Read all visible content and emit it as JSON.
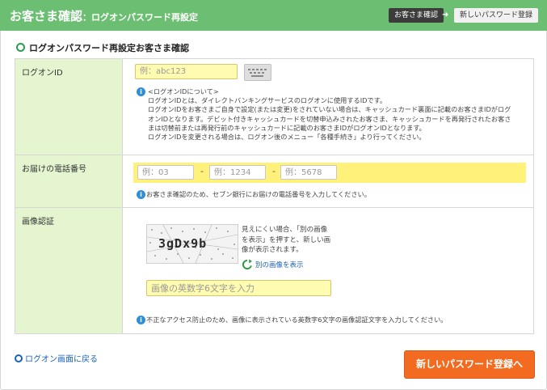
{
  "header": {
    "title": "お客さま確認",
    "subtitle": "：ログオンパスワード再設定",
    "steps": {
      "current": "お客さま確認",
      "next": "新しいパスワード登録"
    },
    "arrow": "➜"
  },
  "section": {
    "heading": "ログオンパスワード再設定お客さま確認"
  },
  "logon": {
    "label": "ログオンID",
    "placeholder": "例：abc123",
    "note_lines": [
      "<ログオンIDについて>",
      "ログオンIDとは、ダイレクトバンキングサービスのログオンに使用するIDです。",
      "ログオンIDをお客さまご自身で設定(または変更)をされていない場合は、キャッシュカード裏面に記載のお客さまIDがログ",
      "オンIDとなります。デビット付きキャッシュカードを切替申込みされたお客さま、キャッシュカードを再発行されたお客さ",
      "まは切替前または再発行前のキャッシュカードに記載のお客さまIDがログオンIDとなります。",
      "ログオンIDを変更される場合は、ログオン後のメニュー「各種手続き」より行ってください。"
    ]
  },
  "phone": {
    "label": "お届けの電話番号",
    "placeholders": [
      "例：03",
      "例：1234",
      "例：5678"
    ],
    "separator": "-",
    "note": "お客さま確認のため、セブン銀行にお届けの電話番号を入力してください。"
  },
  "captcha": {
    "label": "画像認証",
    "image_text": "3gDx9b",
    "help_lines": [
      "見えにくい場合、「別の画像",
      "を表示」を押すと、新しい画",
      "像が表示されます。"
    ],
    "refresh_label": "別の画像を表示",
    "placeholder": "画像の英数字6文字を入力",
    "note": "不正なアクセス防止のため、画像に表示されている英数字6文字の画像認証文字を入力してください。"
  },
  "footer": {
    "back_label": "ログオン画面に戻る",
    "submit_label": "新しいパスワード登録へ"
  },
  "colors": {
    "header_green": "#6cbf72",
    "label_green": "#e4f5cf",
    "input_yellow": "#fffbb0",
    "submit_orange": "#f26b21",
    "link_blue": "#1a62b8"
  }
}
